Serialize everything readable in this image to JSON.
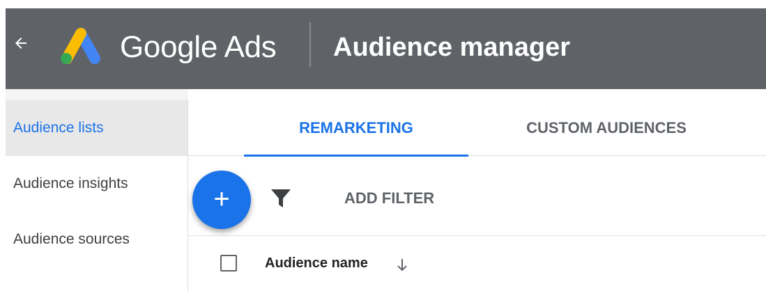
{
  "header": {
    "brand": "Google Ads",
    "page_title": "Audience manager",
    "colors": {
      "bar": "#5f6368",
      "logo_yellow": "#fbbc04",
      "logo_blue": "#4285f4",
      "logo_green": "#34a853"
    }
  },
  "sidebar": {
    "items": [
      {
        "label": "Audience lists",
        "active": true
      },
      {
        "label": "Audience insights",
        "active": false
      },
      {
        "label": "Audience sources",
        "active": false
      }
    ]
  },
  "tabs": [
    {
      "label": "REMARKETING",
      "active": true
    },
    {
      "label": "CUSTOM AUDIENCES",
      "active": false
    }
  ],
  "toolbar": {
    "add_icon": "plus-icon",
    "filter_icon": "funnel-icon",
    "add_filter_label": "ADD FILTER"
  },
  "table": {
    "columns": [
      {
        "label": "Audience name",
        "sort": "descending"
      }
    ]
  },
  "accent_color": "#1a73e8"
}
